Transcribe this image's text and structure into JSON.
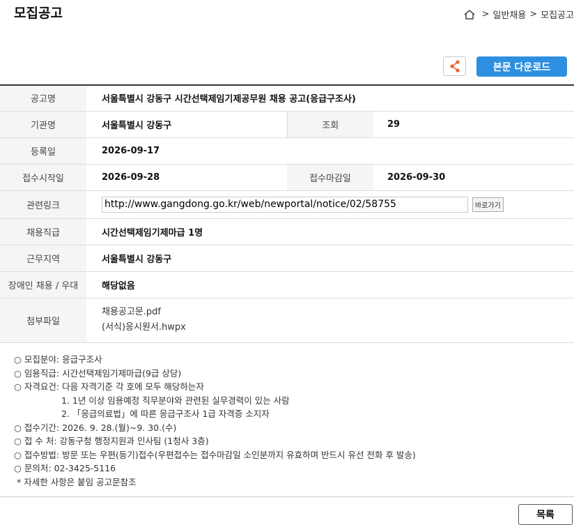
{
  "header": {
    "title": "모집공고",
    "breadcrumb": [
      "일반채용",
      "모집공고"
    ]
  },
  "actions": {
    "download_label": "본문 다운로드"
  },
  "info": {
    "title_label": "공고명",
    "title_value": "서울특별시 강동구 시간선택제임기제공무원 채용 공고(응급구조사)",
    "org_label": "기관명",
    "org_value": "서울특별시 강동구",
    "views_label": "조회",
    "views_value": "29",
    "reg_label": "등록일",
    "reg_value": "2026-09-17",
    "start_label": "접수시작일",
    "start_value": "2026-09-28",
    "end_label": "접수마감일",
    "end_value": "2026-09-30",
    "link_label": "관련링크",
    "link_value": "http://www.gangdong.go.kr/web/newportal/notice/02/58755",
    "link_button": "바로가기",
    "job_label": "채용직급",
    "job_value": "시간선택제임기제마급 1명",
    "area_label": "근무지역",
    "area_value": "서울특별시 강동구",
    "disabled_label": "장애인 채용 / 우대",
    "disabled_value": "해당없음",
    "files_label": "첨부파일",
    "files": [
      "채용공고문.pdf",
      "(서식)응시원서.hwpx"
    ]
  },
  "notes": [
    "○ 모집분야: 응급구조사",
    "○ 임용직급:  시간선택제임기제마급(9급 상당)",
    "○ 자격요건:  다음 자격기준 각 호에 모두 해당하는자",
    "1. 1년 이상 임용예정 직무분야와 관련된 실무경력이 있는 사람",
    "2. 「응급의료법」에 따른 응급구조사 1급 자격증 소지자",
    "○ 접수기간: 2026. 9. 28.(월)~9. 30.(수)",
    "○ 접 수 처: 강동구청 행정지원과 인사팀 (1청사 3층)",
    "○ 접수방법: 방문 또는 우편(등기)접수(우편접수는 접수마감일 소인분까지 유효하며 반드시 유선 전화 후 발송)",
    "○ 문의처: 02-3425-5116",
    "* 자세한 사항은 붙임 공고문참조"
  ],
  "footer": {
    "list_label": "목록"
  },
  "colors": {
    "accent": "#2d8fe0",
    "share_icon": "#e8632c"
  },
  "icons": {
    "home": "home-icon",
    "share": "share-icon"
  }
}
